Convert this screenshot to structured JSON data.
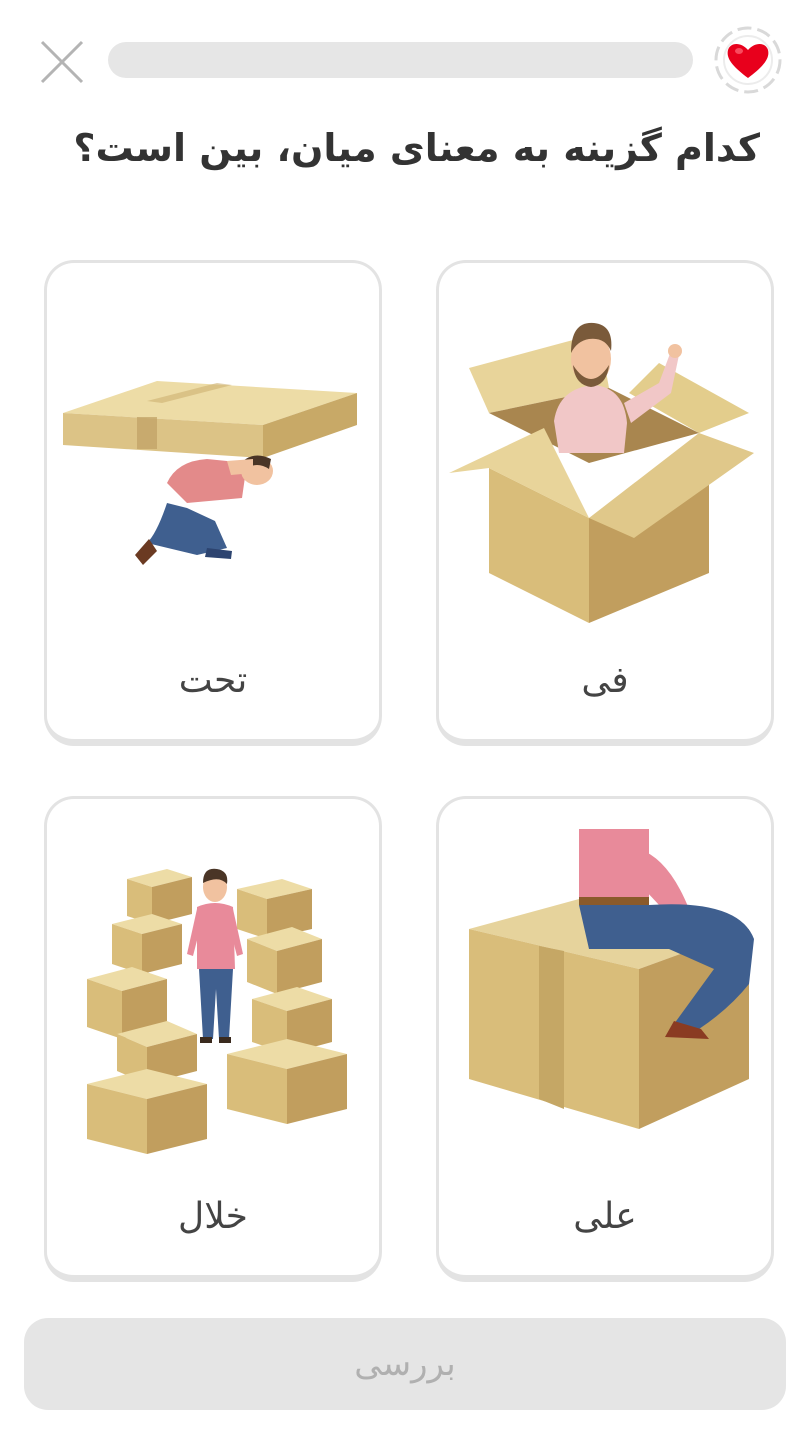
{
  "header": {
    "close_icon": "close-x-icon",
    "progress": 0,
    "lives_icon": "heart-icon",
    "heart_color": "#e8001c"
  },
  "question": "کدام گزینه به معنای میان، بین است؟",
  "options": [
    {
      "label": "فی",
      "icon": "man-in-box-illustration"
    },
    {
      "label": "تحت",
      "icon": "man-under-box-illustration"
    },
    {
      "label": "علی",
      "icon": "man-on-box-illustration"
    },
    {
      "label": "خلال",
      "icon": "man-between-boxes-illustration"
    }
  ],
  "footer": {
    "check_label": "بررسی"
  }
}
